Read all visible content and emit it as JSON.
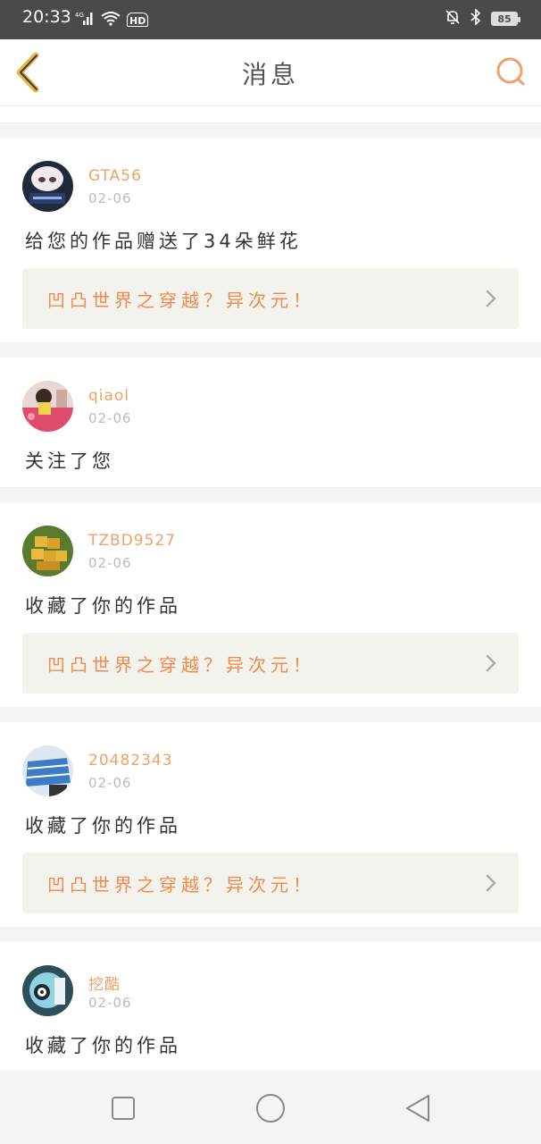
{
  "status_bar": {
    "time": "20:33",
    "network": "4G",
    "hd": "HD",
    "battery": "85"
  },
  "header": {
    "title": "消息",
    "back_icon": "back-chevron-icon",
    "search_icon": "search-icon"
  },
  "messages": [
    {
      "username": "GTA56",
      "date": "02-06",
      "text": "给您的作品赠送了34朵鲜花",
      "work_title": "凹凸世界之穿越？异次元！"
    },
    {
      "username": "qiaol",
      "date": "02-06",
      "text": "关注了您"
    },
    {
      "username": "TZBD9527",
      "date": "02-06",
      "text": "收藏了你的作品",
      "work_title": "凹凸世界之穿越？异次元！"
    },
    {
      "username": "20482343",
      "date": "02-06",
      "text": "收藏了你的作品",
      "work_title": "凹凸世界之穿越？异次元！"
    },
    {
      "username": "挖酷",
      "date": "02-06",
      "text": "收藏了你的作品"
    }
  ],
  "colors": {
    "accent": "#f0a06a",
    "work_title": "#f08a4c",
    "back_icon": "#e8b84a",
    "status_bar": "#4a4a4a"
  },
  "nav": {
    "recent": "square-icon",
    "home": "circle-icon",
    "back": "triangle-back-icon"
  }
}
